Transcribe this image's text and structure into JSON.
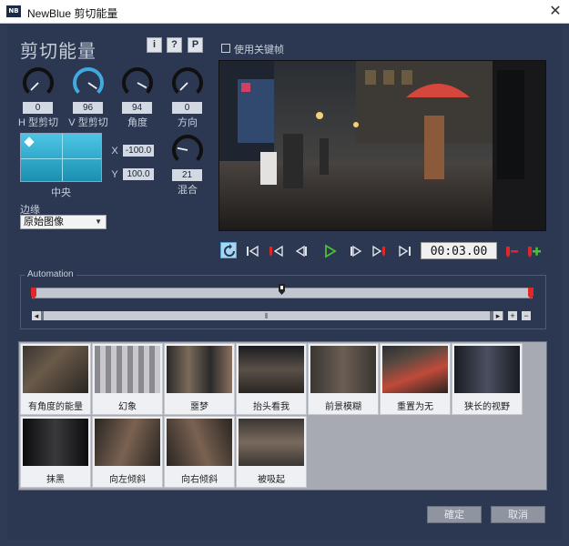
{
  "window": {
    "title": "NewBlue 剪切能量",
    "app_icon_text": "NB"
  },
  "plugin": {
    "title": "剪切能量",
    "info_btn": "i",
    "help_btn": "?",
    "preset_btn": "P"
  },
  "knobs": [
    {
      "value": "0",
      "label": "H 型剪切",
      "fraction": 0.0,
      "color": "#1a1a1a"
    },
    {
      "value": "96",
      "label": "V 型剪切",
      "fraction": 0.96,
      "color": "#3fa9e0"
    },
    {
      "value": "94",
      "label": "角度",
      "fraction": 0.94,
      "color": "#1a1a1a"
    },
    {
      "value": "0",
      "label": "方向",
      "fraction": 0.0,
      "color": "#1a1a1a"
    }
  ],
  "center": {
    "label": "中央",
    "x_label": "X",
    "x_value": "-100.0",
    "y_label": "Y",
    "y_value": "100.0"
  },
  "mix": {
    "value": "21",
    "label": "混合",
    "fraction": 0.21
  },
  "edge": {
    "label": "边缘",
    "selected": "原始图像"
  },
  "keyframes": {
    "label": "使用关键帧",
    "checked": false
  },
  "transport": {
    "timecode": "00:03.00",
    "icons": [
      "loop-icon",
      "go-start-icon",
      "prev-keyframe-icon",
      "step-back-icon",
      "play-icon",
      "step-forward-icon",
      "next-keyframe-icon",
      "go-end-icon",
      "remove-keyframe-icon",
      "add-keyframe-icon"
    ]
  },
  "automation": {
    "label": "Automation",
    "zoom_in": "+",
    "zoom_out": "−"
  },
  "presets": [
    {
      "name": "有角度的能量"
    },
    {
      "name": "幻象"
    },
    {
      "name": "噩梦"
    },
    {
      "name": "抬头看我"
    },
    {
      "name": "前景模糊"
    },
    {
      "name": "重置为无"
    },
    {
      "name": "狭长的视野"
    },
    {
      "name": "抹黑"
    },
    {
      "name": "向左倾斜"
    },
    {
      "name": "向右倾斜"
    },
    {
      "name": "被吸起"
    }
  ],
  "buttons": {
    "ok": "確定",
    "cancel": "取消"
  },
  "colors": {
    "background": "#2c3852",
    "accent": "#3fa9e0",
    "keyframe_red": "#e02828",
    "play_green": "#4bbf3a"
  }
}
